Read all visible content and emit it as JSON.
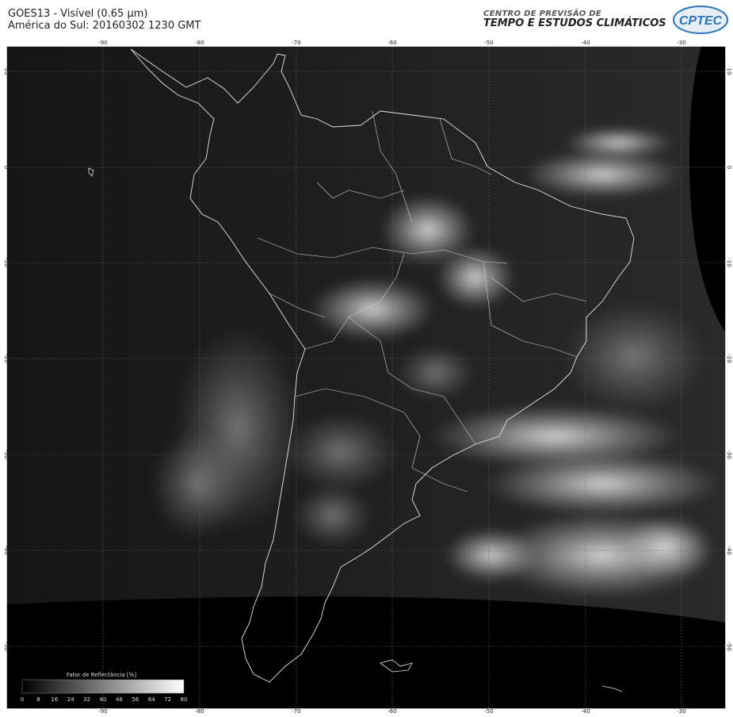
{
  "header": {
    "line1": "GOES13 - Visível (0.65 µm)",
    "line2": "América do Sul: 20160302 1230 GMT",
    "org_line1": "CENTRO DE PREVISÃO DE",
    "org_line2": "TEMPO E ESTUDOS CLIMÁTICOS",
    "logo_text": "CPTEC"
  },
  "map": {
    "lon_labels": [
      "-90",
      "-80",
      "-70",
      "-60",
      "-50",
      "-40",
      "-30"
    ],
    "lat_labels": [
      "10",
      "0",
      "-10",
      "-20",
      "-30",
      "-40",
      "-50"
    ],
    "grid": true
  },
  "colorbar": {
    "title": "Fator de Reflectância [%]",
    "ticks": [
      "0",
      "8",
      "16",
      "24",
      "32",
      "40",
      "48",
      "56",
      "64",
      "72",
      "80"
    ]
  },
  "colors": {
    "background": "#000000",
    "border": "#ffffff",
    "coast": "#e6e6e6",
    "logo_blue": "#2a74b8"
  }
}
